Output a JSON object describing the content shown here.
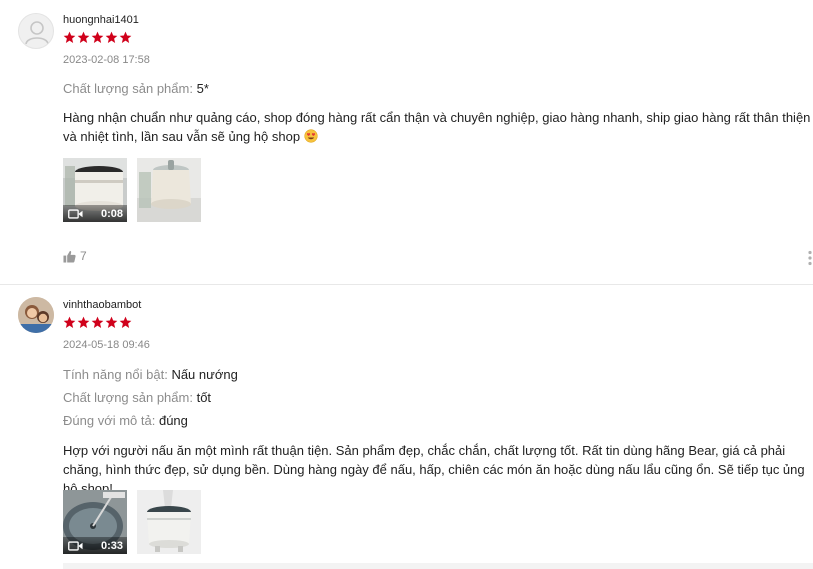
{
  "reviews": [
    {
      "username": "huongnhai1401",
      "rating": 5,
      "datetime": "2023-02-08 17:58",
      "attributes": [
        {
          "key": "Chất lượng sản phẩm:",
          "value": "5*"
        }
      ],
      "text": "Hàng nhận chuẩn như quảng cáo, shop đóng hàng rất cẩn thận và chuyên nghiệp, giao hàng nhanh, ship giao hàng rất thân thiện và nhiệt tình, lần sau vẫn sẽ ủng hộ shop",
      "emoji": "heart-eyes-emoji",
      "media": [
        {
          "type": "video",
          "duration": "0:08"
        },
        {
          "type": "image"
        }
      ],
      "likes": "7"
    },
    {
      "username": "vinhthaobambot",
      "rating": 5,
      "datetime": "2024-05-18 09:46",
      "attributes": [
        {
          "key": "Tính năng nổi bật:",
          "value": "Nấu nướng"
        },
        {
          "key": "Chất lượng sản phẩm:",
          "value": "tốt"
        },
        {
          "key": "Đúng với mô tả:",
          "value": "đúng"
        }
      ],
      "text": "Hợp với người nấu ăn một mình rất thuận tiện. Sản phẩm đẹp, chắc chắn, chất lượng tốt. Rất tin dùng hãng Bear, giá cả phải chăng, hình thức đẹp, sử dụng bền. Dùng hàng ngày để nấu, hấp, chiên các món ăn hoặc dùng nấu lẩu cũng ổn. Sẽ tiếp tục ủng hộ shop!",
      "media": [
        {
          "type": "video",
          "duration": "0:33"
        },
        {
          "type": "image"
        }
      ]
    }
  ],
  "colors": {
    "star": "#d0011b",
    "muted_text": "#8c8c8c",
    "date_text": "#888888"
  },
  "icons": [
    "user-placeholder-icon",
    "star-icon",
    "video-camera-icon",
    "thumbs-up-icon",
    "more-vertical-icon"
  ]
}
